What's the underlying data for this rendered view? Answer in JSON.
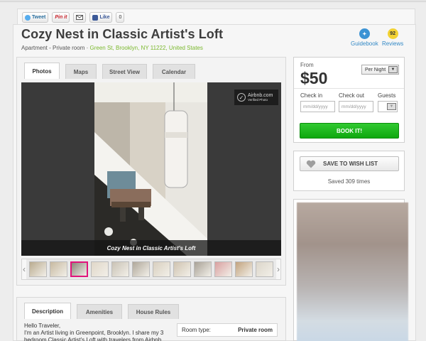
{
  "social": {
    "tweet": "Tweet",
    "pinit": "Pin it",
    "like": "Like",
    "like_count": "0"
  },
  "listing": {
    "title": "Cozy Nest in Classic Artist's Loft",
    "type": "Apartment - Private room",
    "separator": "·",
    "location": "Green St, Brooklyn, NY 11222, United States"
  },
  "header_links": {
    "guidebook": "Guidebook",
    "reviews": "Reviews",
    "reviews_count": "92"
  },
  "photo_tabs": [
    "Photos",
    "Maps",
    "Street View",
    "Calendar"
  ],
  "photo": {
    "caption": "Cozy Nest in Classic Artist's Loft",
    "verified_title": "Airbnb.com",
    "verified_sub": "Verified Photo",
    "thumbnail_count": 12,
    "selected_thumbnail": 3
  },
  "booking": {
    "from_label": "From",
    "price": "$50",
    "period": "Per Night",
    "checkin_label": "Check in",
    "checkout_label": "Check out",
    "guests_label": "Guests",
    "checkin_placeholder": "mm/dd/yyyy",
    "checkout_placeholder": "mm/dd/yyyy",
    "book_button": "BOOK IT!"
  },
  "wishlist": {
    "button": "SAVE TO WISH LIST",
    "saved_text": "Saved 309 times"
  },
  "desc_tabs": [
    "Description",
    "Amenities",
    "House Rules"
  ],
  "description": {
    "greeting": "Hello Traveler,",
    "body": "I'm an Artist living in Greenpoint, Brooklyn. I share my 3 bedroom Classic Artist's Loft with travelers from Airbnb."
  },
  "details": {
    "room_type_label": "Room type:",
    "room_type_value": "Private room"
  },
  "colors": {
    "accent_green": "#1db51d",
    "location_green": "#7ab82c",
    "link_blue": "#3389c6",
    "thumb_selected": "#e0147b"
  }
}
